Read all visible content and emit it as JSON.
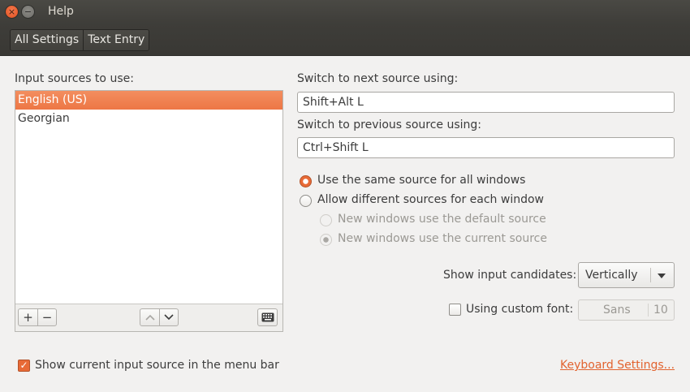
{
  "window": {
    "title": "Help",
    "close_glyph": "×",
    "minimize_glyph": "−"
  },
  "breadcrumbs": [
    "All Settings",
    "Text Entry"
  ],
  "input_sources": {
    "label": "Input sources to use:",
    "items": [
      {
        "label": "English (US)",
        "selected": true
      },
      {
        "label": "Georgian",
        "selected": false
      }
    ],
    "toolbar": {
      "add": "+",
      "remove": "−",
      "move_up": "up-arrow-icon",
      "move_down": "down-arrow-icon",
      "keyboard": "keyboard-icon"
    }
  },
  "next_source": {
    "label": "Switch to next source using:",
    "value": "Shift+Alt L"
  },
  "prev_source": {
    "label": "Switch to previous source using:",
    "value": "Ctrl+Shift L"
  },
  "radios": {
    "same_source": {
      "label": "Use the same source for all windows",
      "checked": true
    },
    "different_sources": {
      "label": "Allow different sources for each window",
      "checked": false
    },
    "default_source": {
      "label": "New windows use the default source",
      "checked": false,
      "enabled": false
    },
    "current_source": {
      "label": "New windows use the current source",
      "checked": true,
      "enabled": false
    }
  },
  "candidates": {
    "label": "Show input candidates:",
    "value": "Vertically"
  },
  "custom_font": {
    "label": "Using custom font:",
    "checked": false,
    "font_name": "Sans",
    "font_size": "10"
  },
  "menu_bar": {
    "label": "Show current input source in the menu bar",
    "checked": true,
    "check_glyph": "✓"
  },
  "keyboard_link": "Keyboard Settings...",
  "colors": {
    "accent": "#e86a36",
    "selection": "#f07f4f",
    "link": "#e2632f",
    "titlebar": "#3e3d39"
  }
}
